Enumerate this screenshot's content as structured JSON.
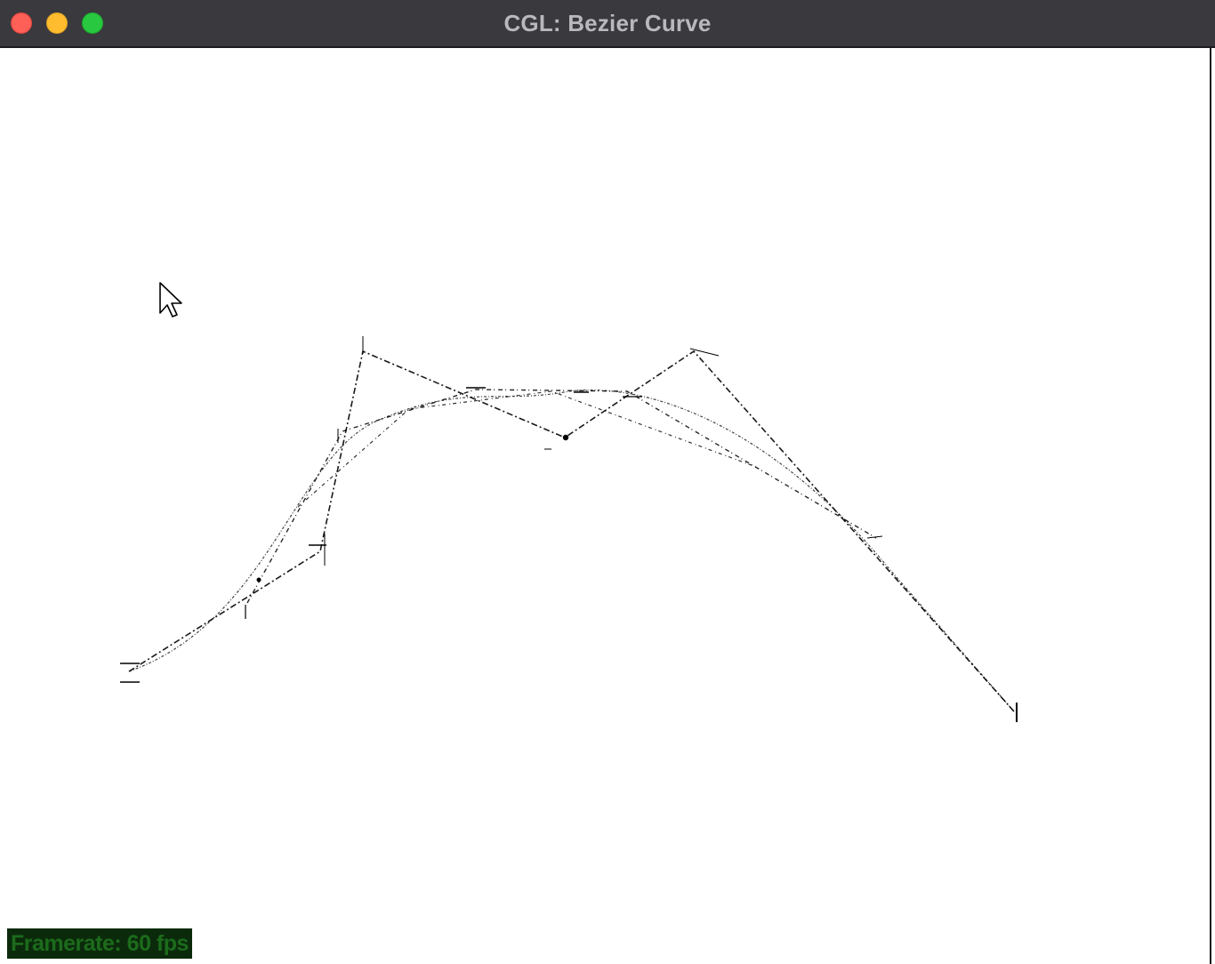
{
  "window": {
    "title": "CGL: Bezier Curve"
  },
  "traffic_lights": {
    "close_color": "#fe5f57",
    "minimize_color": "#febc2e",
    "maximize_color": "#28c840"
  },
  "status": {
    "framerate": "Framerate: 60 fps"
  },
  "colors": {
    "titlebar": "#3a393e",
    "canvas_background": "#ffffff",
    "curve_stroke": "#000000",
    "framerate_text": "#1c6b1c"
  },
  "icons": {
    "cursor": "mouse-pointer-icon"
  }
}
